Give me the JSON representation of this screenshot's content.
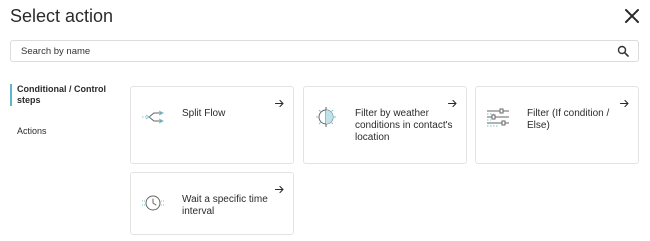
{
  "dialog": {
    "title": "Select action",
    "close_icon": "close-icon"
  },
  "search": {
    "placeholder": "Search by name",
    "value": "",
    "icon": "search-icon"
  },
  "nav": {
    "items": [
      {
        "label": "Conditional / Control steps",
        "active": true
      },
      {
        "label": "Actions",
        "active": false
      }
    ]
  },
  "cards": [
    {
      "label": "Split Flow",
      "icon": "split-flow-icon",
      "arrow_icon": "arrow-right-icon"
    },
    {
      "label": "Filter by weather conditions in contact's location",
      "icon": "weather-filter-icon",
      "arrow_icon": "arrow-right-icon"
    },
    {
      "label": "Filter (If condition / Else)",
      "icon": "filter-sliders-icon",
      "arrow_icon": "arrow-right-icon"
    },
    {
      "label": "Wait a specific time interval",
      "icon": "clock-icon",
      "arrow_icon": "arrow-right-icon"
    }
  ],
  "colors": {
    "accent": "#5db7c9",
    "icon_teal": "#7fc4d2",
    "border": "#e3e3e3",
    "text": "#2b2b2b"
  }
}
